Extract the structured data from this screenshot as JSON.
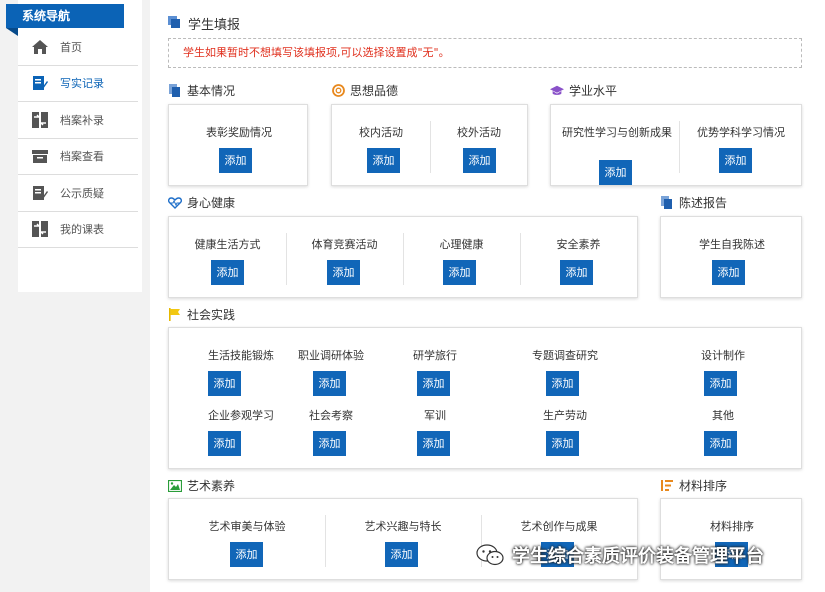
{
  "sidebar": {
    "title": "系统导航",
    "items": [
      {
        "label": "首页",
        "icon": "home-icon"
      },
      {
        "label": "写实记录",
        "icon": "edit-record-icon"
      },
      {
        "label": "档案补录",
        "icon": "transfer-icon"
      },
      {
        "label": "档案查看",
        "icon": "archive-box-icon"
      },
      {
        "label": "公示质疑",
        "icon": "edit-doc-icon"
      },
      {
        "label": "我的课表",
        "icon": "transfer-icon"
      }
    ],
    "active_index": 1,
    "accent": "#0b63b6"
  },
  "header": {
    "title": "学生填报",
    "notice": "学生如果暂时不想填写该填报项,可以选择设置成\"无\"。"
  },
  "add_label": "添加",
  "sections": {
    "basic": {
      "title": "基本情况",
      "items": [
        "表彰奖励情况"
      ]
    },
    "moral": {
      "title": "思想品德",
      "items": [
        "校内活动",
        "校外活动"
      ]
    },
    "academic": {
      "title": "学业水平",
      "items": [
        "研究性学习与创新成果",
        "优势学科学习情况"
      ]
    },
    "health": {
      "title": "身心健康",
      "items": [
        "健康生活方式",
        "体育竞赛活动",
        "心理健康",
        "安全素养"
      ]
    },
    "report": {
      "title": "陈述报告",
      "items": [
        "学生自我陈述"
      ]
    },
    "social": {
      "title": "社会实践",
      "items": [
        "生活技能锻炼",
        "职业调研体验",
        "研学旅行",
        "专题调查研究",
        "设计制作",
        "企业参观学习",
        "社会考察",
        "军训",
        "生产劳动",
        "其他"
      ]
    },
    "art": {
      "title": "艺术素养",
      "items": [
        "艺术审美与体验",
        "艺术兴趣与特长",
        "艺术创作与成果"
      ]
    },
    "materials": {
      "title": "材料排序",
      "items": [
        "材料排序"
      ]
    }
  },
  "watermark": "学生综合素质评价装备管理平台",
  "colors": {
    "button": "#1166b8",
    "notice": "#e0301e",
    "nav_title": "#0b63b6"
  }
}
